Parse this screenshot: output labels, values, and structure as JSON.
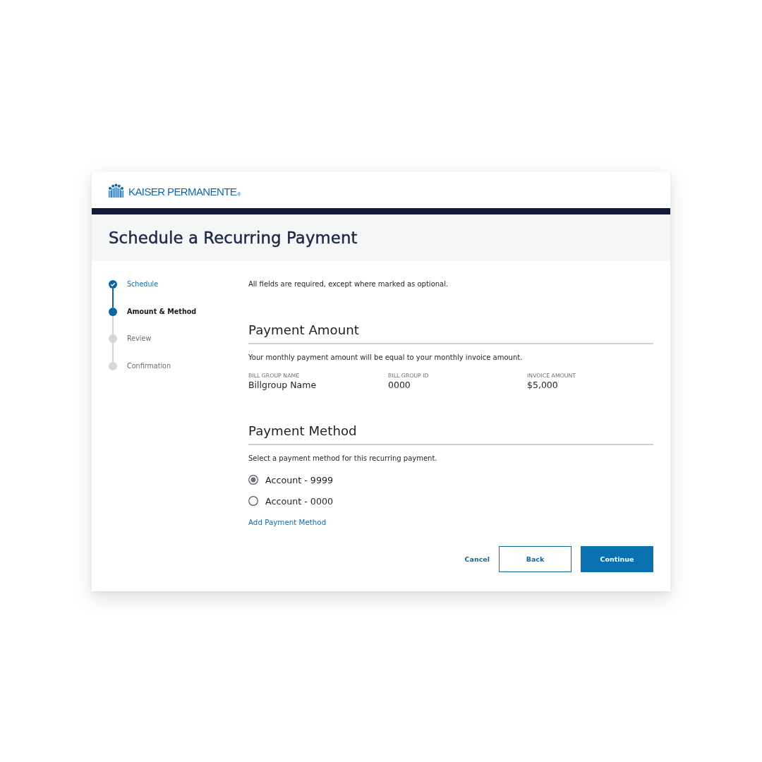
{
  "brand": {
    "name": "KAISER PERMANENTE",
    "mark": "®"
  },
  "page_title": "Schedule a Recurring Payment",
  "steps": [
    {
      "label": "Schedule",
      "completed": true,
      "selected": false
    },
    {
      "label": "Amount & Method",
      "completed": false,
      "selected": true
    },
    {
      "label": "Review",
      "completed": false,
      "selected": false
    },
    {
      "label": "Confirmation",
      "completed": false,
      "selected": false
    }
  ],
  "intro": "All fields are required, except where marked as optional.",
  "payment_amount": {
    "heading": "Payment Amount",
    "description": "Your monthly payment amount will be equal to your monthly invoice amount.",
    "fields": [
      {
        "label": "BILL GROUP NAME",
        "value": "Billgroup Name"
      },
      {
        "label": "BILL GROUP ID",
        "value": "0000"
      },
      {
        "label": "INVOICE AMOUNT",
        "value": "$5,000"
      }
    ]
  },
  "payment_method": {
    "heading": "Payment Method",
    "description": "Select a payment method for this recurring payment.",
    "options": [
      {
        "label": "Account - 9999",
        "selected": true
      },
      {
        "label": "Account - 0000",
        "selected": false
      }
    ],
    "add_link": "Add Payment Method"
  },
  "actions": [
    {
      "kind": "link",
      "label": "Cancel"
    },
    {
      "kind": "secondary",
      "label": "Back"
    },
    {
      "kind": "primary",
      "label": "Continue"
    }
  ]
}
